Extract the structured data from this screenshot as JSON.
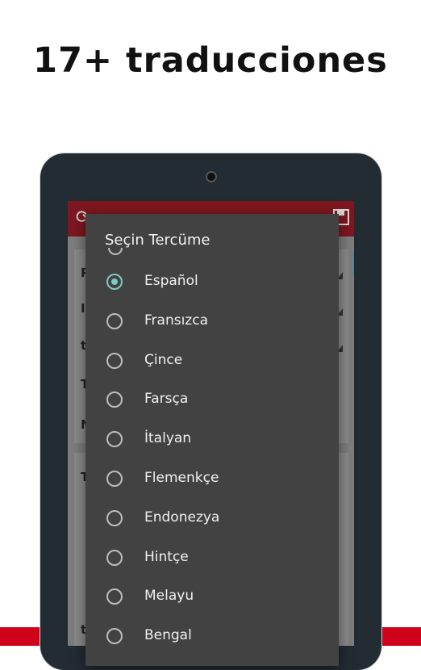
{
  "headline": "17+ traducciones",
  "dialog": {
    "title": "Seçin Tercüme",
    "selected_index": 0,
    "options": [
      {
        "label": "Español"
      },
      {
        "label": "Fransızca"
      },
      {
        "label": "Çince"
      },
      {
        "label": "Farsça"
      },
      {
        "label": "İtalyan"
      },
      {
        "label": "Flemenkçe"
      },
      {
        "label": "Endonezya"
      },
      {
        "label": "Hintçe"
      },
      {
        "label": "Melayu"
      },
      {
        "label": "Bengal"
      }
    ]
  },
  "background_app": {
    "toolbar_icons": [
      "refresh-icon",
      "save-icon"
    ],
    "visible_letters": [
      "P",
      "I",
      "t",
      "T",
      "N",
      "T",
      "t"
    ]
  },
  "colors": {
    "accent": "#7fc9c0",
    "brand_red": "#d0021b",
    "dialog_bg": "#424242",
    "tablet_frame": "#232b33"
  }
}
